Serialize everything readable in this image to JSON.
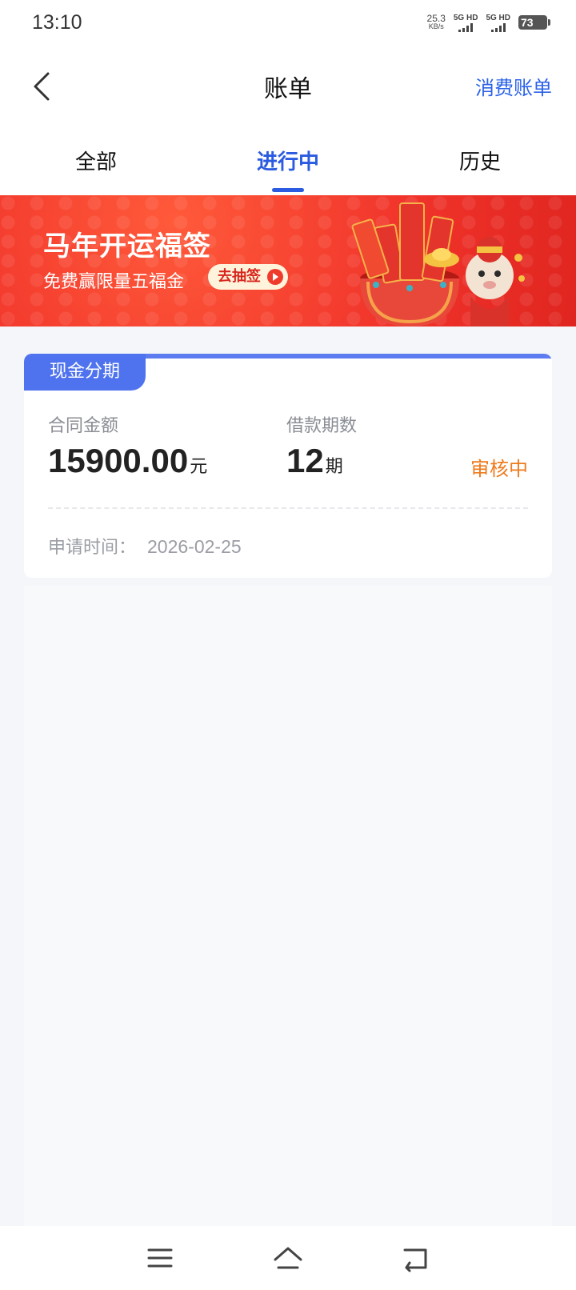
{
  "status_bar": {
    "time": "13:10",
    "net_speed_value": "25.3",
    "net_speed_unit": "KB/s",
    "sim1_label": "5G HD",
    "sim2_label": "5G HD",
    "battery": "73"
  },
  "header": {
    "back_icon": "chevron-left-icon",
    "title": "账单",
    "right_link": "消费账单"
  },
  "tabs": [
    {
      "label": "全部",
      "active": false
    },
    {
      "label": "进行中",
      "active": true
    },
    {
      "label": "历史",
      "active": false
    }
  ],
  "banner": {
    "title": "马年开运福签",
    "subtitle": "免费赢限量五福金",
    "cta": "去抽签",
    "colors": {
      "background": "#f1352c",
      "cta_bg": "#fff3dc"
    }
  },
  "card": {
    "tag": "现金分期",
    "contract_amount_label": "合同金额",
    "contract_amount_value": "15900.00",
    "contract_amount_unit": "元",
    "loan_periods_label": "借款期数",
    "loan_periods_value": "12",
    "loan_periods_unit": "期",
    "status": "审核中",
    "apply_time_label": "申请时间：",
    "apply_time_value": "2026-02-25",
    "colors": {
      "accent": "#4f73ee",
      "status": "#ee7a1c"
    }
  },
  "bottom_nav": {
    "icons": [
      "menu-icon",
      "home-icon",
      "back-icon"
    ]
  }
}
